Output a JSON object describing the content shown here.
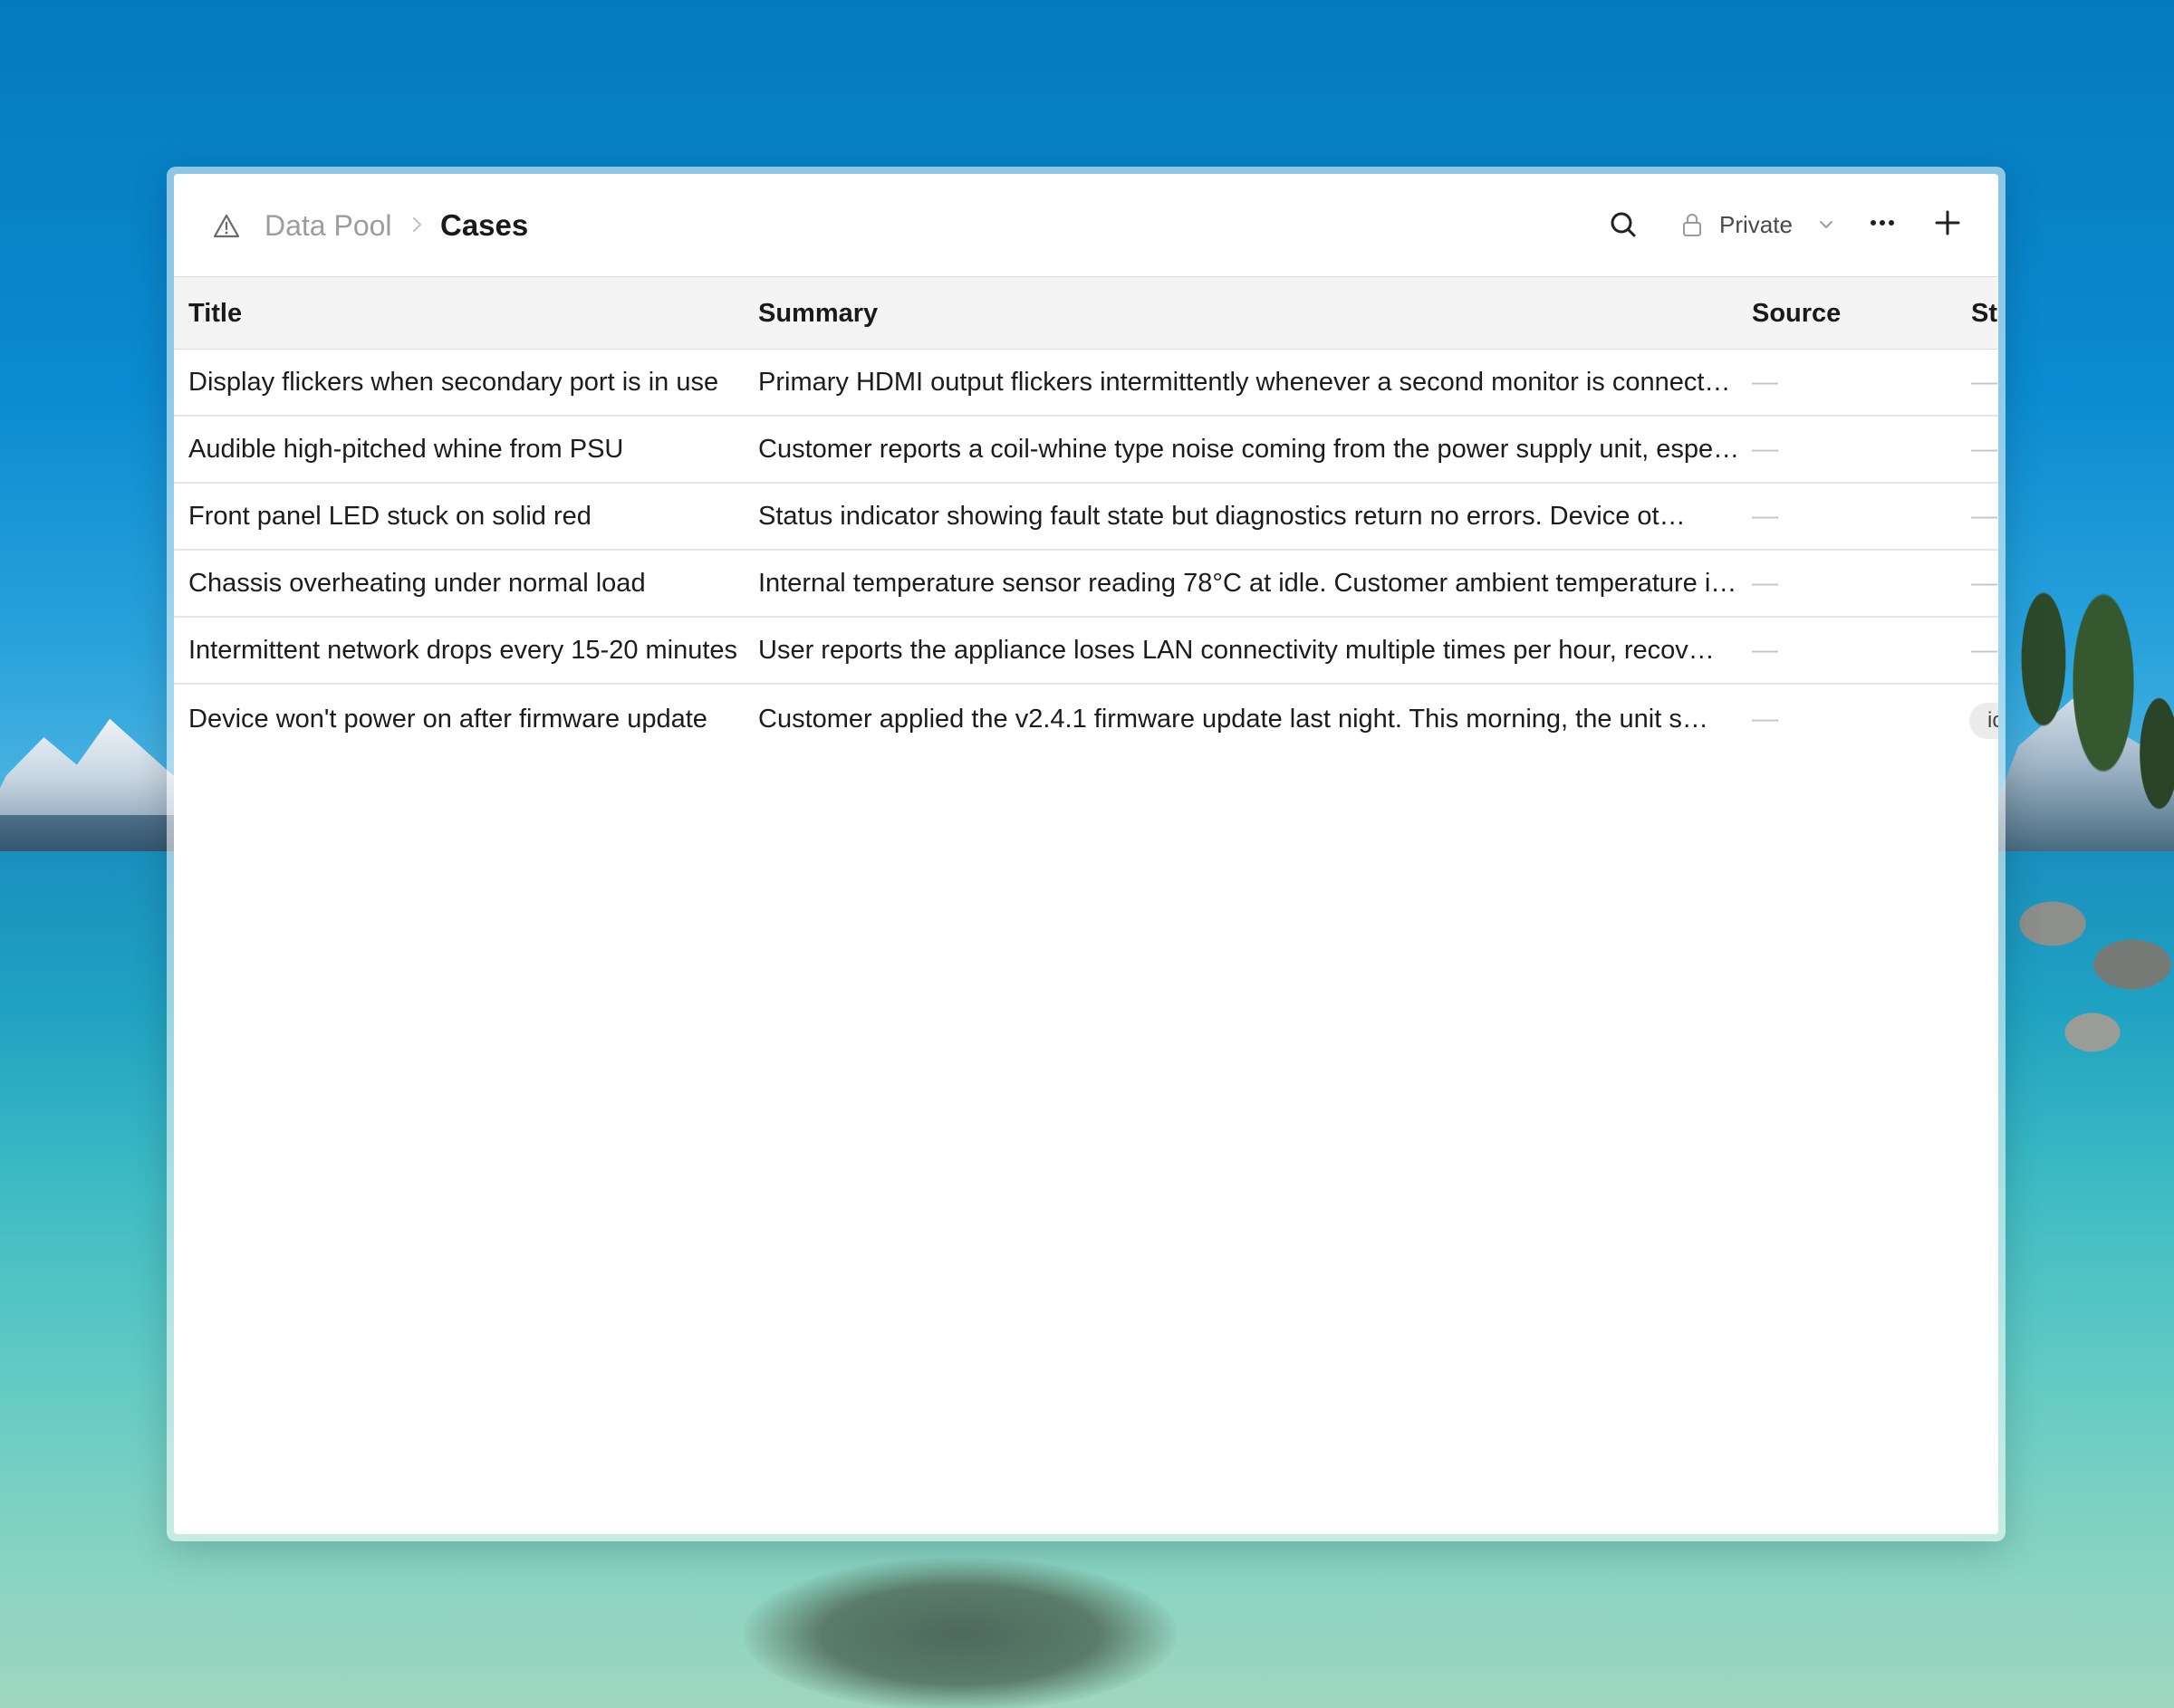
{
  "breadcrumb": {
    "parent": "Data Pool",
    "current": "Cases"
  },
  "toolbar": {
    "visibility_label": "Private"
  },
  "icons": {
    "crumb": "warning-triangle-icon",
    "separator": "chevron-right-icon",
    "search": "search-icon",
    "lock": "lock-icon",
    "dropdown": "chevron-down-icon",
    "more": "more-horizontal-icon",
    "add": "plus-icon"
  },
  "colors": {
    "header_bg": "#f4f4f4",
    "muted_text": "#9d9d9d",
    "placeholder_dash": "#c4c4c4"
  },
  "table": {
    "columns": [
      "Title",
      "Summary",
      "Source",
      "Sta"
    ],
    "rows": [
      {
        "title": "Display flickers when secondary port is in use",
        "summary": "Primary HDMI output flickers intermittently whenever a second monitor is connect…",
        "source": "—",
        "status": "—"
      },
      {
        "title": "Audible high-pitched whine from PSU",
        "summary": "Customer reports a coil-whine type noise coming from the power supply unit, espe…",
        "source": "—",
        "status": "—"
      },
      {
        "title": "Front panel LED stuck on solid red",
        "summary": "Status indicator showing fault state but diagnostics return no errors. Device ot…",
        "source": "—",
        "status": "—"
      },
      {
        "title": "Chassis overheating under normal load",
        "summary": "Internal temperature sensor reading 78°C at idle. Customer ambient temperature i…",
        "source": "—",
        "status": "—"
      },
      {
        "title": "Intermittent network drops every 15-20 minutes",
        "summary": "User reports the appliance loses LAN connectivity multiple times per hour, recov…",
        "source": "—",
        "status": "—"
      },
      {
        "title": "Device won't power on after firmware update",
        "summary": "Customer applied the v2.4.1 firmware update last night. This morning, the unit s…",
        "source": "—",
        "status": "ic"
      }
    ]
  }
}
